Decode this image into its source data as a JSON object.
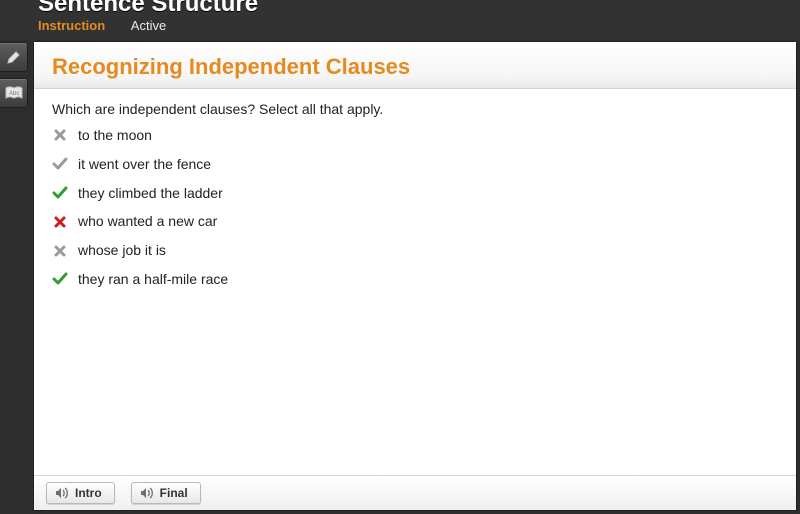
{
  "header": {
    "title": "Sentence Structure",
    "tabs": [
      {
        "label": "Instruction",
        "active": true
      },
      {
        "label": "Active",
        "active": false
      }
    ]
  },
  "lesson": {
    "title": "Recognizing Independent Clauses",
    "prompt": "Which are independent clauses? Select all that apply.",
    "options": [
      {
        "text": "to the moon",
        "state": "wrong-gray"
      },
      {
        "text": "it went over the fence",
        "state": "right-gray"
      },
      {
        "text": "they climbed the ladder",
        "state": "right-green"
      },
      {
        "text": "who wanted a new car",
        "state": "wrong-red"
      },
      {
        "text": "whose job it is",
        "state": "wrong-gray"
      },
      {
        "text": "they ran a half-mile race",
        "state": "right-green"
      }
    ]
  },
  "footer": {
    "buttons": [
      {
        "label": "Intro"
      },
      {
        "label": "Final"
      }
    ]
  },
  "colors": {
    "accent": "#e58a1f",
    "green": "#2e9e2e",
    "red": "#cc1e1e",
    "gray": "#9a9a9a"
  }
}
